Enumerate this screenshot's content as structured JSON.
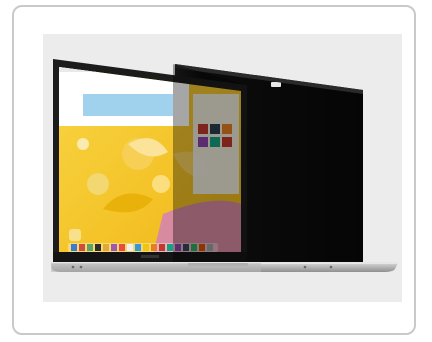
{
  "image": {
    "subject": "laptop-with-privacy-filter",
    "colors": {
      "frame_border": "#c9c9c9",
      "photo_bg": "#ececec",
      "bezel": "#1c1c1c",
      "wallpaper_yellow": "#f6c31d",
      "wallpaper_pink": "#d88aa0",
      "filter_black": "#0a0a0a",
      "base_silver": "#bfbfbf"
    }
  },
  "screen": {
    "dock_icon_count": 18
  }
}
